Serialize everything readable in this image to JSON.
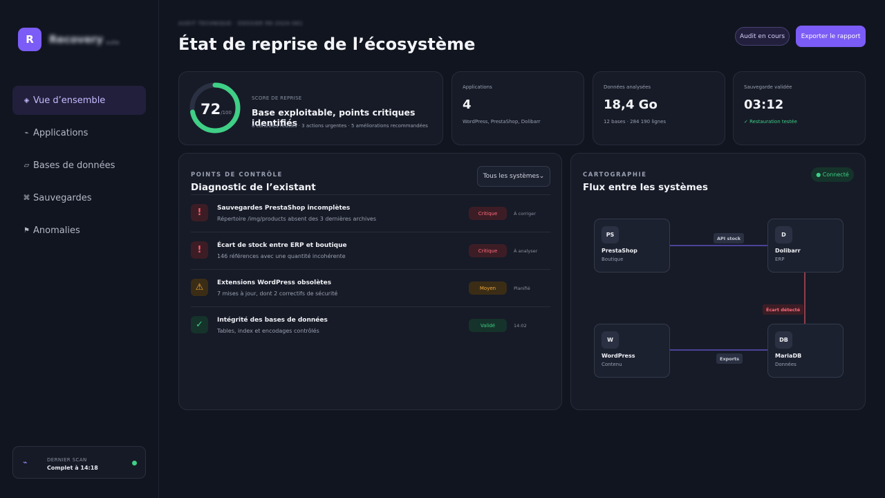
{
  "brand": {
    "logo": "R",
    "name": "Recovery",
    "tag": "suite"
  },
  "nav": [
    {
      "icon": "◈",
      "label": "Vue d’ensemble"
    },
    {
      "icon": "⌁",
      "label": "Applications"
    },
    {
      "icon": "▱",
      "label": "Bases de données"
    },
    {
      "icon": "⌘",
      "label": "Sauvegardes"
    },
    {
      "icon": "⚑",
      "label": "Anomalies"
    }
  ],
  "scan": {
    "icon": "⌁",
    "title": "DERNIER SCAN",
    "status": "Complet à 14:18"
  },
  "header": {
    "eyebrow": "AUDIT TECHNIQUE · DOSSIER RE-2024-061",
    "title": "État de reprise de l’écosystème",
    "status_button": "Audit en cours",
    "export_button": "Exporter le rapport"
  },
  "score": {
    "value": "72",
    "max": "/100",
    "percent": 72,
    "label": "SCORE DE REPRISE",
    "headline": "Base exploitable, points critiques identifiés",
    "detail": "8 contrôles réussis · 3 actions urgentes · 5 améliorations recommandées"
  },
  "stats": [
    {
      "label": "Applications",
      "value": "4",
      "sub": "WordPress, PrestaShop, Dolibarr"
    },
    {
      "label": "Données analysées",
      "value": "18,4 Go",
      "sub": "12 bases · 284 190 lignes"
    },
    {
      "label": "Sauvegarde validée",
      "value": "03:12",
      "sub": "✓ Restauration testée"
    }
  ],
  "checks_panel": {
    "kicker": "POINTS DE CONTRÔLE",
    "title": "Diagnostic de l’existant",
    "filter": "Tous les systèmes⌄",
    "rows": [
      {
        "icon": "!",
        "title": "Sauvegardes PrestaShop incomplètes",
        "desc": "Répertoire /img/products absent des 3 dernières archives",
        "badge": "Critique",
        "state": "À corriger"
      },
      {
        "icon": "!",
        "title": "Écart de stock entre ERP et boutique",
        "desc": "146 références avec une quantité incohérente",
        "badge": "Critique",
        "state": "À analyser"
      },
      {
        "icon": "⚠",
        "title": "Extensions WordPress obsolètes",
        "desc": "7 mises à jour, dont 2 correctifs de sécurité",
        "badge": "Moyen",
        "state": "Planifié"
      },
      {
        "icon": "✓",
        "title": "Intégrité des bases de données",
        "desc": "Tables, index et encodages contrôlés",
        "badge": "Validé",
        "state": "14:02"
      }
    ]
  },
  "map_panel": {
    "kicker": "CARTOGRAPHIE",
    "title": "Flux entre les systèmes",
    "status": "● Connecté",
    "nodes": {
      "prestashop": {
        "badge": "PS",
        "name": "PrestaShop",
        "role": "Boutique"
      },
      "dolibarr": {
        "badge": "D",
        "name": "Dolibarr",
        "role": "ERP"
      },
      "wordpress": {
        "badge": "W",
        "name": "WordPress",
        "role": "Contenu"
      },
      "mariadb": {
        "badge": "DB",
        "name": "MariaDB",
        "role": "Données"
      }
    },
    "edges": {
      "api": "API stock",
      "gap": "Écart détecté",
      "exports": "Exports"
    }
  },
  "colors": {
    "accent": "#7c5cf6",
    "ok": "#3fcf86",
    "critical": "#ff5b6c",
    "warning": "#f0a83c"
  }
}
